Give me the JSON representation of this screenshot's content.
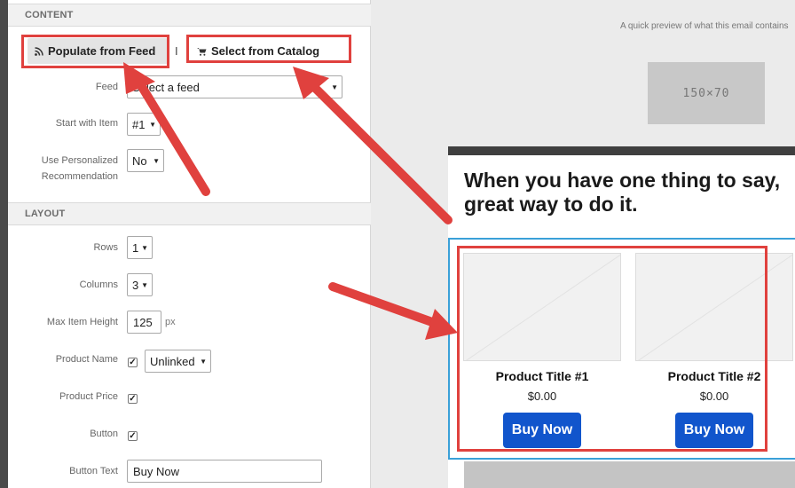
{
  "panel": {
    "content_section": {
      "header": "CONTENT",
      "populate_button": "Populate from Feed",
      "populate_icon": "rss-icon",
      "separator": "I",
      "catalog_button": "Select from Catalog",
      "catalog_icon": "cart-icon",
      "feed_label": "Feed",
      "feed_value": "Select a feed",
      "start_label": "Start with Item",
      "start_value": "#1",
      "personalized_label_line1": "Use Personalized",
      "personalized_label_line2": "Recommendation",
      "personalized_value": "No"
    },
    "layout_section": {
      "header": "LAYOUT",
      "rows_label": "Rows",
      "rows_value": "1",
      "columns_label": "Columns",
      "columns_value": "3",
      "max_height_label": "Max Item Height",
      "max_height_value": "125",
      "max_height_unit": "px",
      "product_name_label": "Product Name",
      "product_name_checked": true,
      "product_name_link": "Unlinked",
      "product_price_label": "Product Price",
      "product_price_checked": true,
      "button_label": "Button",
      "button_checked": true,
      "button_text_label": "Button Text",
      "button_text_value": "Buy Now"
    }
  },
  "preview": {
    "caption": "A quick preview of what this email contains",
    "image_placeholder": "150×70",
    "heading": "When you have one thing to say,\ngreat way to do it.",
    "products": [
      {
        "title": "Product Title #1",
        "price": "$0.00",
        "button": "Buy Now"
      },
      {
        "title": "Product Title #2",
        "price": "$0.00",
        "button": "Buy Now"
      }
    ]
  },
  "colors": {
    "highlight": "#e0413e",
    "buy_button": "#1155cc",
    "selection_frame": "#3aa0d8"
  }
}
